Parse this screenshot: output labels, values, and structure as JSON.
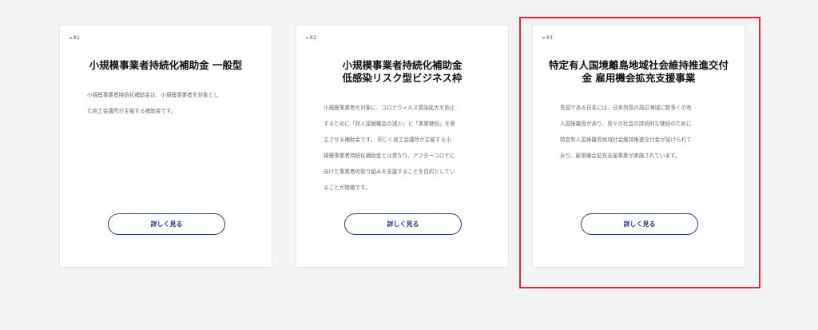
{
  "cards": [
    {
      "number": "01",
      "title": "小規模事業者持続化補助金 一般型",
      "description": "小規模事業者持続化補助金は、小規模事業者を対象とし\nた商工会議所が主催する補助金です。",
      "button_label": "詳しく見る"
    },
    {
      "number": "02",
      "title": "小規模事業者持続化補助金\n低感染リスク型ビジネス枠",
      "description": "小規模事業者を対象に、コロナウィルス感染拡大を防止\nするために「対人接触機会の減少」と「事業継続」を両\n立させる補助金です。 同じく商工会議所が主催する小\n規模事業者持続化補助金とは異なり、アフターコロナに\n向けた事業者の取り組みを支援することを目的としてい\nることが特徴です。",
      "button_label": "詳しく見る"
    },
    {
      "number": "03",
      "title": "特定有人国境離島地域社会維持推進交付\n金 雇用機会拡充支援事業",
      "description": "島国である日本には、日本列島の周辺海域に数多くの有\n人国境離島があり、島々の社会の持続的な継続のために\n特定有人国境離島地域社会維持推進交付金が設けられて\nおり、雇用機会拡充支援事業が実施されています。",
      "button_label": "詳しく見る"
    }
  ],
  "colors": {
    "background": "#f2f4f6",
    "accent": "#1e3a8a",
    "highlight": "#e32636"
  }
}
